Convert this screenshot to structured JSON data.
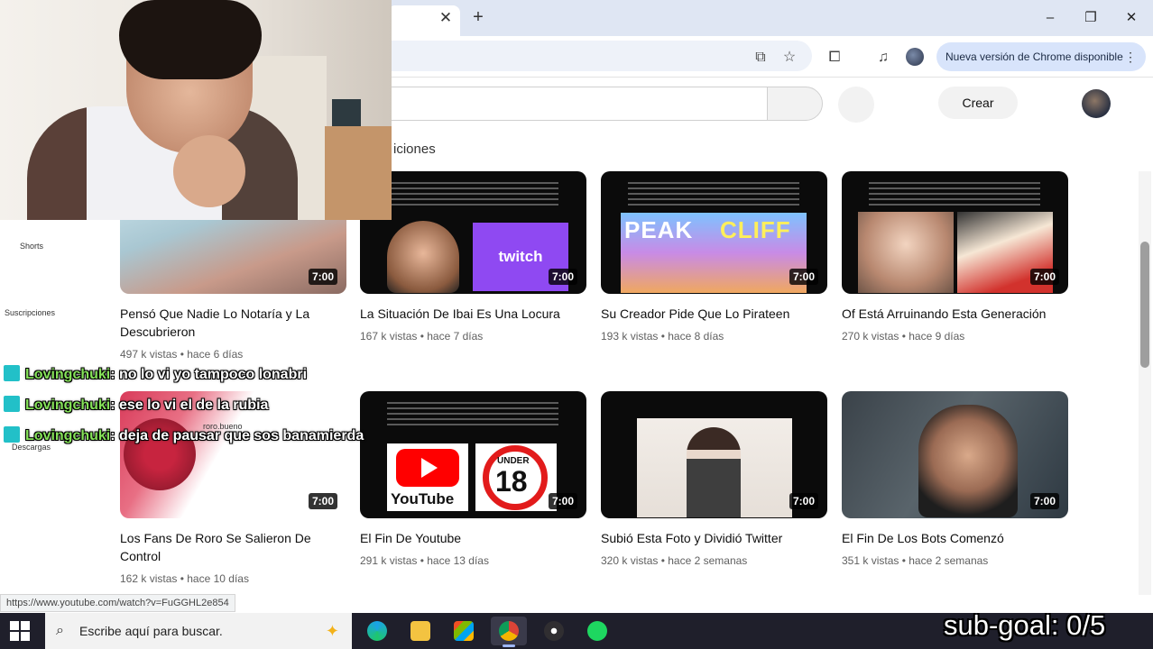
{
  "browser": {
    "tab_close_glyph": "✕",
    "new_tab_glyph": "+",
    "window_controls": [
      "–",
      "❐",
      "✕"
    ],
    "update_label": "Nueva versión de Chrome disponible",
    "menu_glyph": "⋮",
    "status_url": "https://www.youtube.com/watch?v=FuGGHL2e854"
  },
  "youtube": {
    "create_label": "Crear",
    "chip_partial": "iciones",
    "guide": [
      "Shorts",
      "Suscripciones",
      "Descargas"
    ],
    "videos": [
      {
        "title": "Pensó Que Nadie Lo Notaría y La Descubrieron",
        "meta": "497 k vistas • hace 6 días",
        "duration": "7:00"
      },
      {
        "title": "La Situación De Ibai Es Una Locura",
        "meta": "167 k vistas • hace 7 días",
        "duration": "7:00"
      },
      {
        "title": "Su Creador Pide Que Lo Pirateen",
        "meta": "193 k vistas • hace 8 días",
        "duration": "7:00"
      },
      {
        "title": "Of Está Arruinando Esta Generación",
        "meta": "270 k vistas • hace 9 días",
        "duration": "7:00"
      },
      {
        "title": "Los Fans De Roro Se Salieron De Control",
        "meta": "162 k vistas • hace 10 días",
        "duration": "7:00"
      },
      {
        "title": "El Fin De Youtube",
        "meta": "291 k vistas • hace 13 días",
        "duration": "7:00"
      },
      {
        "title": "Subió Esta Foto y Dividió Twitter",
        "meta": "320 k vistas • hace 2 semanas",
        "duration": "7:00"
      },
      {
        "title": "El Fin De Los Bots Comenzó",
        "meta": "351 k vistas • hace 2 semanas",
        "duration": "7:00"
      }
    ],
    "thumb_text": {
      "twitch": "twitch",
      "peak": "PEAK",
      "cliff": "CLIFF",
      "youtube": "YouTube",
      "under": "UNDER",
      "eighteen": "18",
      "roro_handle": "roro.bueno"
    }
  },
  "chat": [
    {
      "user": "Lovingchuki",
      "message": ": no lo vi yo tampoco lonabri"
    },
    {
      "user": "Lovingchuki",
      "message": ": ese lo vi el de la rubia"
    },
    {
      "user": "Lovingchuki",
      "message": ": deja de pausar que sos banamierda"
    }
  ],
  "taskbar": {
    "search_placeholder": "Escribe aquí para buscar.",
    "subgoal": "sub-goal: 0/5"
  },
  "colors": {
    "chat_user": "#86e35a",
    "twitch": "#8f49f2",
    "youtube_red": "#ff0000",
    "update_pill": "#d8e4fb"
  }
}
